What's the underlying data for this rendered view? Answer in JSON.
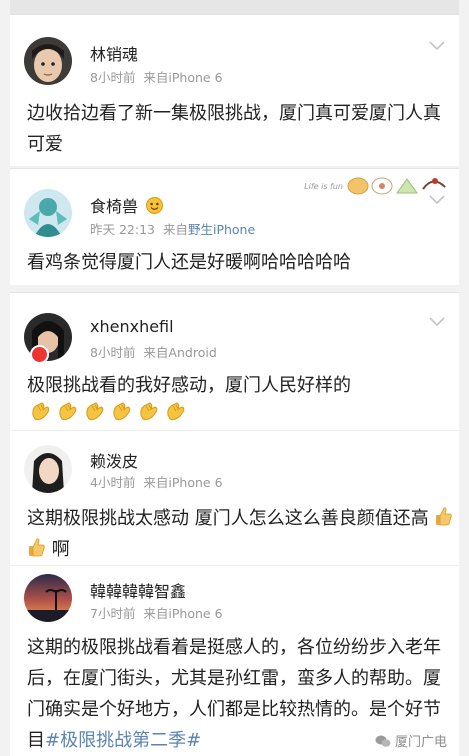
{
  "posts": [
    {
      "username": "林销魂",
      "time": "8小时前",
      "source_prefix": "来自",
      "source": "iPhone 6",
      "text": "边收拾边看了新一集极限挑战，厦门真可爱厦门人真可爱"
    },
    {
      "username": "食椅兽",
      "time": "昨天 22:13",
      "source_prefix": "来自",
      "source": "野生iPhone",
      "text": "看鸡条觉得厦门人还是好暖啊哈哈哈哈哈",
      "decoration_text": "Life is fun"
    },
    {
      "username": "xhenxhefil",
      "time": "8小时前",
      "source_prefix": "来自",
      "source": "Android",
      "text": "极限挑战看的我好感动，厦门人民好样的",
      "emoji": "clap",
      "emoji_count": 6
    },
    {
      "username": "赖泼皮",
      "time": "4小时前",
      "source_prefix": "来自",
      "source": "iPhone 6",
      "text": "这期极限挑战太感动 厦门人怎么这么善良颜值还高",
      "text_tail": "啊",
      "emoji": "thumbs-up",
      "emoji_count": 2
    },
    {
      "username": "韓韓韓韓智鑫",
      "time": "7小时前",
      "source_prefix": "来自",
      "source": "iPhone 6",
      "text": "这期的极限挑战看着是挺感人的，各位纷纷步入老年后，在厦门街头，尤其是孙红雷，蛮多人的帮助。厦门确实是个好地方，人们都是比较热情的。是个好节目",
      "hashtag": "#极限挑战第二季#"
    }
  ],
  "watermark": "厦门广电",
  "colors": {
    "link": "#5b84b3",
    "meta": "#999999",
    "vip": "#e33333"
  }
}
